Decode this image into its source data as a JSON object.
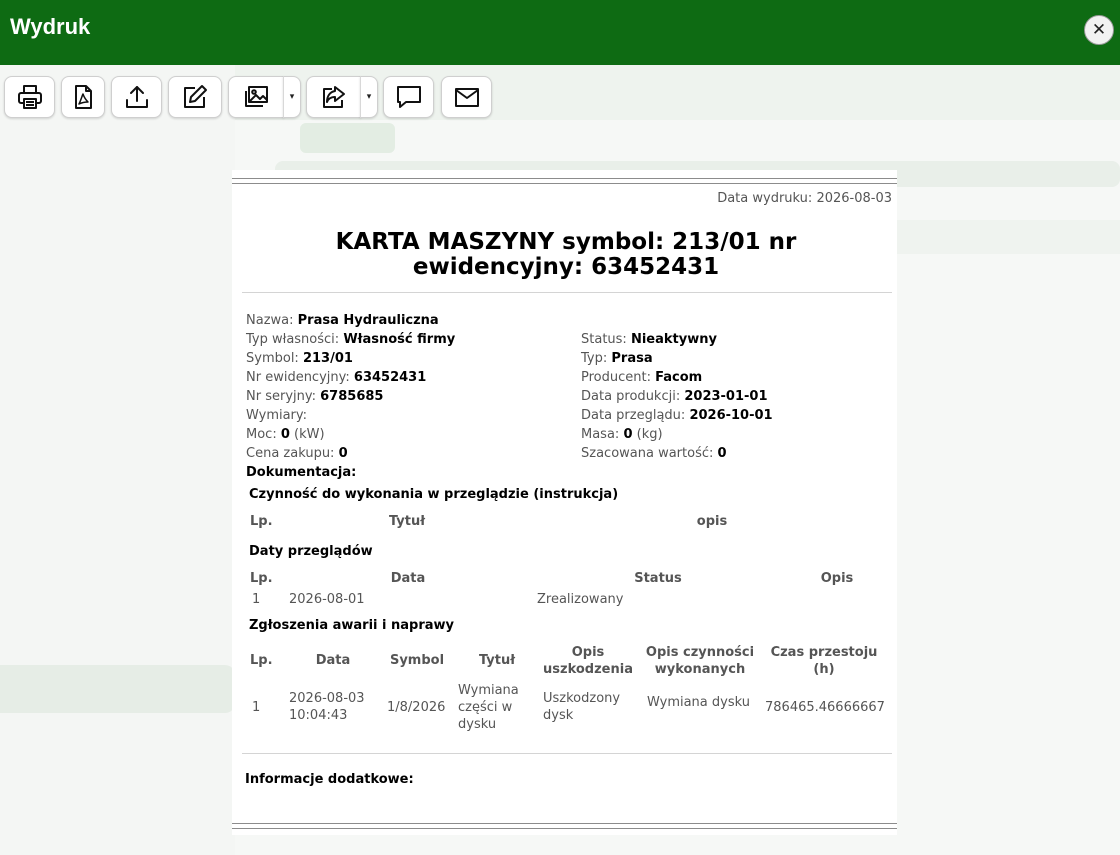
{
  "header": {
    "title": "Wydruk",
    "close_symbol": "✕"
  },
  "toolbar": {
    "buttons": [
      {
        "name": "print-button",
        "icon": "printer-icon"
      },
      {
        "name": "pdf-button",
        "icon": "pdf-file-icon"
      },
      {
        "name": "export-button",
        "icon": "upload-icon"
      },
      {
        "name": "edit-button",
        "icon": "edit-icon"
      },
      {
        "name": "images-button",
        "icon": "images-icon"
      },
      {
        "name": "share-button",
        "icon": "share-icon"
      },
      {
        "name": "comment-button",
        "icon": "comment-icon"
      },
      {
        "name": "email-button",
        "icon": "envelope-icon"
      }
    ],
    "dropdown_symbol": "▾"
  },
  "document": {
    "print_date_label": "Data wydruku:",
    "print_date": "2026-08-03",
    "title_line1": "KARTA MASZYNY symbol: 213/01 nr",
    "title_line2": "ewidencyjny: 63452431",
    "left_fields": [
      {
        "label": "Nazwa:",
        "value": "Prasa Hydrauliczna",
        "suffix": ""
      },
      {
        "label": "Typ własności:",
        "value": "Własność firmy",
        "suffix": ""
      },
      {
        "label": "Symbol:",
        "value": "213/01",
        "suffix": ""
      },
      {
        "label": "Nr ewidencyjny:",
        "value": "63452431",
        "suffix": ""
      },
      {
        "label": "Nr seryjny:",
        "value": "6785685",
        "suffix": ""
      },
      {
        "label": "Wymiary:",
        "value": "",
        "suffix": ""
      },
      {
        "label": "Moc:",
        "value": "0",
        "suffix": "(kW)"
      },
      {
        "label": "Cena zakupu:",
        "value": "0",
        "suffix": ""
      }
    ],
    "right_fields": [
      {
        "label": "Status:",
        "value": "Nieaktywny",
        "suffix": ""
      },
      {
        "label": "Typ:",
        "value": "Prasa",
        "suffix": ""
      },
      {
        "label": "Producent:",
        "value": "Facom",
        "suffix": ""
      },
      {
        "label": "Data produkcji:",
        "value": "2023-01-01",
        "suffix": ""
      },
      {
        "label": "Data przeglądu:",
        "value": "2026-10-01",
        "suffix": ""
      },
      {
        "label": "Masa:",
        "value": "0",
        "suffix": "(kg)"
      },
      {
        "label": "Szacowana wartość:",
        "value": "0",
        "suffix": ""
      }
    ],
    "documentation_label": "Dokumentacja:",
    "instructions": {
      "title": "Czynność do wykonania w przeglądzie (instrukcja)",
      "headers": [
        "Lp.",
        "Tytuł",
        "opis"
      ]
    },
    "inspections": {
      "title": "Daty przeglądów",
      "headers": [
        "Lp.",
        "Data",
        "Status",
        "Opis"
      ],
      "rows": [
        {
          "lp": "1",
          "data": "2026-08-01",
          "status": "Zrealizowany",
          "opis": ""
        }
      ]
    },
    "failures": {
      "title": "Zgłoszenia awarii i naprawy",
      "headers": [
        "Lp.",
        "Data",
        "Symbol",
        "Tytuł",
        "Opis\nuszkodzenia",
        "Opis czynności\nwykonanych",
        "Czas przestoju\n(h)"
      ],
      "rows": [
        {
          "lp": "1",
          "data": "2026-08-03\n10:04:43",
          "symbol": "1/8/2026",
          "tytul": "Wymiana\nczęści w\ndysku",
          "opis_uszkodzenia": "Uszkodzony\ndysk",
          "opis_czynnosci": "Wymiana dysku",
          "czas": "786465.46666667"
        }
      ]
    },
    "additional_info_label": "Informacje dodatkowe:"
  }
}
